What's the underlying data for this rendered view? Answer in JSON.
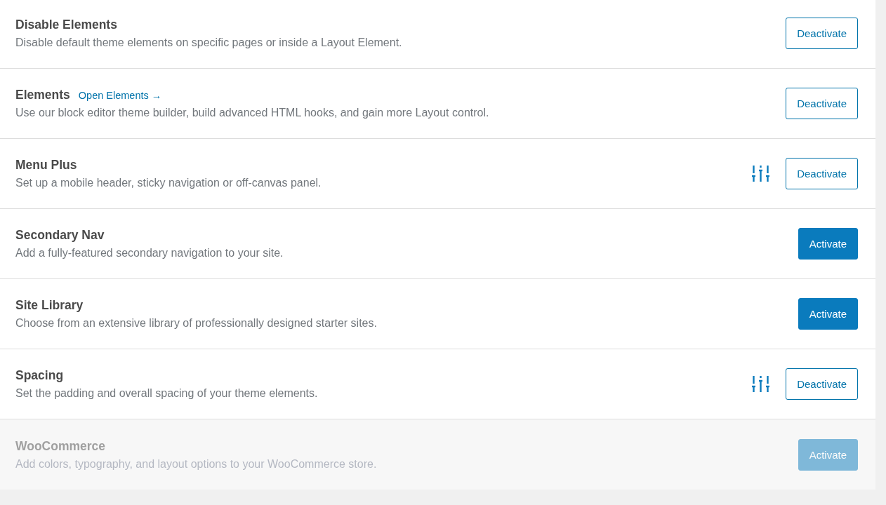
{
  "modules": [
    {
      "title": "Disable Elements",
      "description": "Disable default theme elements on specific pages or inside a Layout Element.",
      "settings": false,
      "active": true,
      "disabled": false,
      "button": "Deactivate"
    },
    {
      "title": "Elements",
      "link": "Open Elements →",
      "description": "Use our block editor theme builder, build advanced HTML hooks, and gain more Layout control.",
      "settings": false,
      "active": true,
      "disabled": false,
      "button": "Deactivate"
    },
    {
      "title": "Menu Plus",
      "description": "Set up a mobile header, sticky navigation or off-canvas panel.",
      "settings": true,
      "active": true,
      "disabled": false,
      "button": "Deactivate"
    },
    {
      "title": "Secondary Nav",
      "description": "Add a fully-featured secondary navigation to your site.",
      "settings": false,
      "active": false,
      "disabled": false,
      "button": "Activate"
    },
    {
      "title": "Site Library",
      "description": "Choose from an extensive library of professionally designed starter sites.",
      "settings": false,
      "active": false,
      "disabled": false,
      "button": "Activate"
    },
    {
      "title": "Spacing",
      "description": "Set the padding and overall spacing of your theme elements.",
      "settings": true,
      "active": true,
      "disabled": false,
      "button": "Deactivate"
    },
    {
      "title": "WooCommerce",
      "description": "Add colors, typography, and layout options to your WooCommerce store.",
      "settings": false,
      "active": false,
      "disabled": true,
      "button": "Activate"
    }
  ]
}
